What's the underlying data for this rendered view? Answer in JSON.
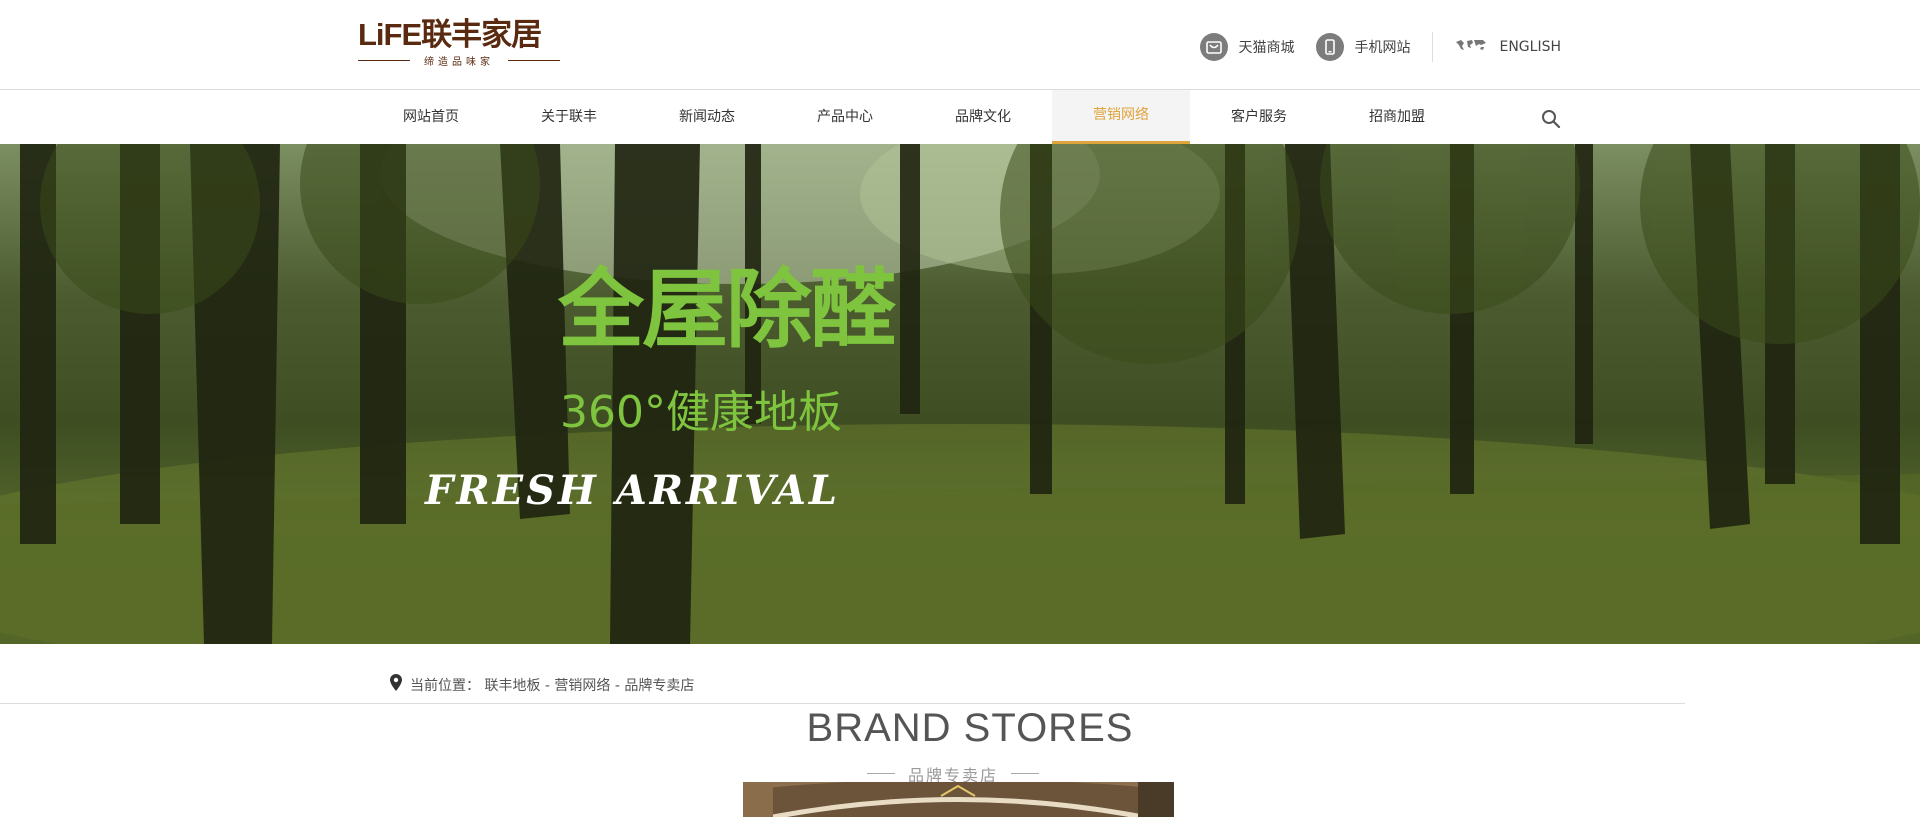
{
  "header": {
    "logo": {
      "brand": "LiFE联丰家居",
      "tagline": "缔造品味家"
    },
    "links": [
      {
        "label": "天猫商城",
        "icon": "tmall-bag-icon"
      },
      {
        "label": "手机网站",
        "icon": "mobile-phone-icon"
      },
      {
        "label": "ENGLISH",
        "icon": "world-map-icon"
      }
    ]
  },
  "nav": {
    "items": [
      {
        "label": "网站首页"
      },
      {
        "label": "关于联丰"
      },
      {
        "label": "新闻动态"
      },
      {
        "label": "产品中心"
      },
      {
        "label": "品牌文化"
      },
      {
        "label": "营销网络"
      },
      {
        "label": "客户服务"
      },
      {
        "label": "招商加盟"
      }
    ],
    "active_index": 5
  },
  "banner": {
    "title": "全屋除醛",
    "subtitle": "360°健康地板",
    "tagline": "FRESH ARRIVAL"
  },
  "breadcrumb": {
    "text": "当前位置： 联丰地板 - 营销网络 - 品牌专卖店"
  },
  "section": {
    "heading_en": "BRAND STORES",
    "heading_cn": "品牌专卖店"
  },
  "colors": {
    "accent": "#e0a43c",
    "brand": "#5a2a10",
    "banner_text": "#7fc43e"
  }
}
